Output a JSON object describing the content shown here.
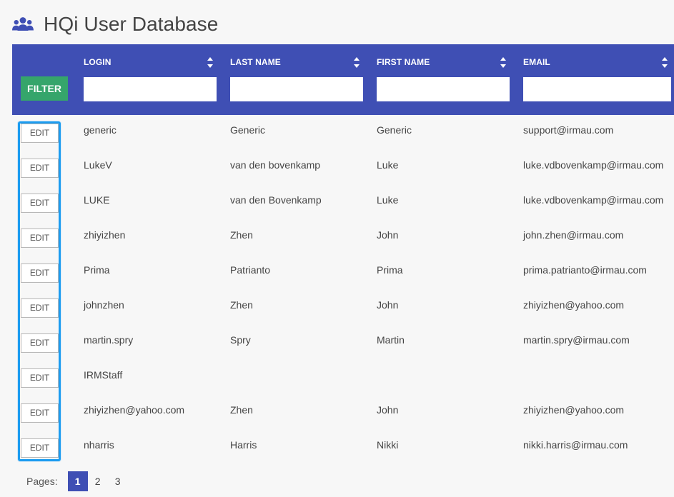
{
  "app": {
    "title": "HQi User Database",
    "icon": "users-icon"
  },
  "theme": {
    "header_bg": "#3f4fb4",
    "filter_button_bg": "#35a56b",
    "highlight_border": "#1c9cf0"
  },
  "table": {
    "filter_label": "FILTER",
    "columns": [
      {
        "label": "LOGIN",
        "filter_value": ""
      },
      {
        "label": "LAST NAME",
        "filter_value": ""
      },
      {
        "label": "FIRST NAME",
        "filter_value": ""
      },
      {
        "label": "EMAIL",
        "filter_value": ""
      }
    ],
    "rows": [
      {
        "action": "EDIT",
        "login": "generic",
        "last_name": "Generic",
        "first_name": "Generic",
        "email": "support@irmau.com"
      },
      {
        "action": "EDIT",
        "login": "LukeV",
        "last_name": "van den bovenkamp",
        "first_name": "Luke",
        "email": "luke.vdbovenkamp@irmau.com"
      },
      {
        "action": "EDIT",
        "login": "LUKE",
        "last_name": "van den Bovenkamp",
        "first_name": "Luke",
        "email": "luke.vdbovenkamp@irmau.com"
      },
      {
        "action": "EDIT",
        "login": "zhiyizhen",
        "last_name": "Zhen",
        "first_name": "John",
        "email": "john.zhen@irmau.com"
      },
      {
        "action": "EDIT",
        "login": "Prima",
        "last_name": "Patrianto",
        "first_name": "Prima",
        "email": "prima.patrianto@irmau.com"
      },
      {
        "action": "EDIT",
        "login": "johnzhen",
        "last_name": "Zhen",
        "first_name": "John",
        "email": "zhiyizhen@yahoo.com"
      },
      {
        "action": "EDIT",
        "login": "martin.spry",
        "last_name": "Spry",
        "first_name": "Martin",
        "email": "martin.spry@irmau.com"
      },
      {
        "action": "EDIT",
        "login": "IRMStaff",
        "last_name": "",
        "first_name": "",
        "email": ""
      },
      {
        "action": "EDIT",
        "login": "zhiyizhen@yahoo.com",
        "last_name": "Zhen",
        "first_name": "John",
        "email": "zhiyizhen@yahoo.com"
      },
      {
        "action": "EDIT",
        "login": "nharris",
        "last_name": "Harris",
        "first_name": "Nikki",
        "email": "nikki.harris@irmau.com"
      }
    ]
  },
  "pagination": {
    "label": "Pages:",
    "pages": [
      "1",
      "2",
      "3"
    ],
    "current": "1"
  }
}
